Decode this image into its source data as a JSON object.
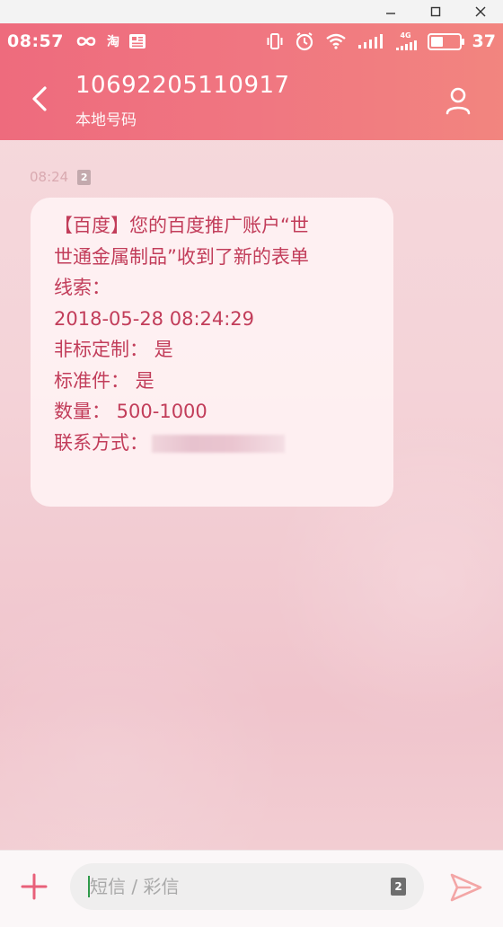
{
  "window": {
    "minimize_glyph": "—",
    "maximize_glyph": "☐",
    "close_glyph": "✕"
  },
  "status_bar": {
    "time": "08:57",
    "left_icons": [
      "infinity-icon",
      "taobao-icon",
      "news-icon"
    ],
    "right_icons": [
      "vibrate-icon",
      "alarm-icon",
      "wifi-icon",
      "signal-icon",
      "signal-4g-icon",
      "battery-icon"
    ],
    "taobao_glyph": "淘",
    "network_label": "4G",
    "battery_percent": "37",
    "battery_level": 0.37
  },
  "title_bar": {
    "contact_number": "10692205110917",
    "contact_subtitle": "本地号码"
  },
  "conversation": {
    "message_time": "08:24",
    "sim_label": "2",
    "message_lines": [
      "【百度】您的百度推广账户“世",
      "世通金属制品”收到了新的表单",
      "线索：",
      "2018-05-28 08:24:29",
      "非标定制： 是",
      "标准件： 是",
      "数量： 500-1000",
      "联系方式："
    ]
  },
  "composer": {
    "placeholder": "短信 / 彩信",
    "sim_label": "2"
  },
  "colors": {
    "header_start": "#ee6b7d",
    "header_end": "#f2857f",
    "message_text": "#c23d5a",
    "background": "#f4d3d8",
    "send_icon": "#f3a6a6"
  }
}
